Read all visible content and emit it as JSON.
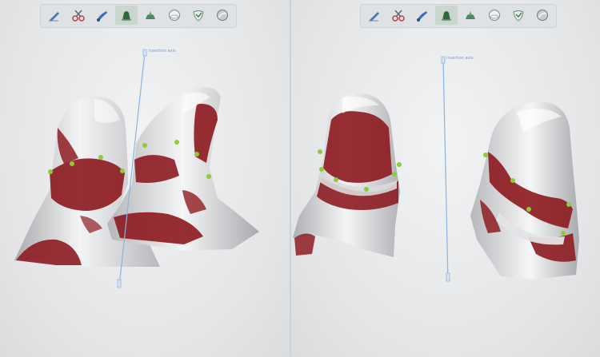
{
  "colors": {
    "tooth_surface": "#cfd0d2",
    "contact_area": "#8e1c22",
    "margin_point": "#8ccc3a",
    "axis_line": "#8fb2e0",
    "toolbar_active": "#c9d7cf"
  },
  "toolbar": {
    "tools": [
      {
        "icon": "pen-icon"
      },
      {
        "icon": "cut-icon"
      },
      {
        "icon": "brush-icon"
      },
      {
        "icon": "crown-icon",
        "active": true
      },
      {
        "icon": "abutment-icon"
      },
      {
        "icon": "sphere-icon"
      },
      {
        "icon": "shield-icon"
      },
      {
        "icon": "ball-icon"
      }
    ]
  },
  "viewports": {
    "left": {
      "axis_label": "Insertion axis"
    },
    "right": {
      "axis_label": "Insertion axis"
    }
  }
}
